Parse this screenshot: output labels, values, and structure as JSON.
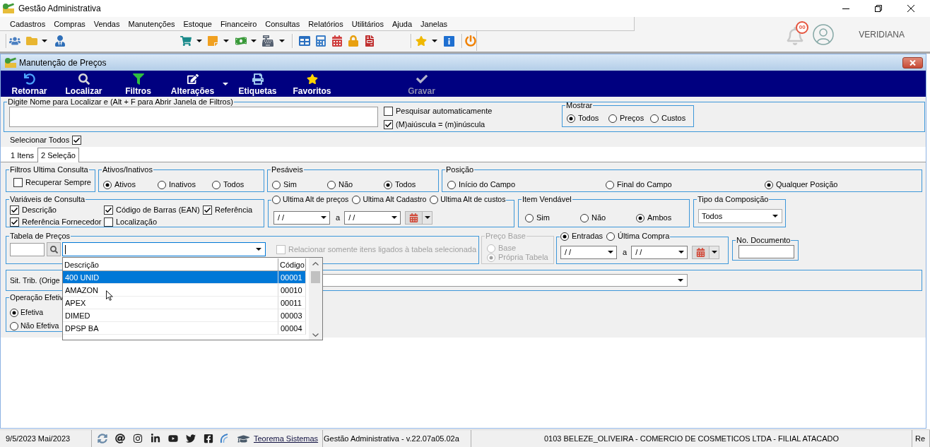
{
  "app_window": {
    "title": "Gestão Administrativa"
  },
  "menu_bar": [
    "Cadastros",
    "Compras",
    "Vendas",
    "Manutenções",
    "Estoque",
    "Financeiro",
    "Consultas",
    "Relatórios",
    "Utilitários",
    "Ajuda",
    "Janelas"
  ],
  "user_area": {
    "notifications": "00",
    "user_name": "VERIDIANA"
  },
  "child_window": {
    "title": "Manutenção de Preços"
  },
  "action_bar": [
    {
      "kind": "return",
      "label": "Retornar",
      "disabled": false,
      "has_menu": false
    },
    {
      "kind": "search",
      "label": "Localizar",
      "disabled": false,
      "has_menu": false
    },
    {
      "kind": "filter",
      "label": "Filtros",
      "disabled": false,
      "has_menu": false
    },
    {
      "kind": "edit",
      "label": "Alterações",
      "disabled": false,
      "has_menu": true
    },
    {
      "kind": "print",
      "label": "Etiquetas",
      "disabled": false,
      "has_menu": false
    },
    {
      "kind": "favorite",
      "label": "Favoritos",
      "disabled": false,
      "has_menu": false
    },
    {
      "kind": "save",
      "label": "Gravar",
      "disabled": true,
      "has_menu": false
    }
  ],
  "search": {
    "label": "Digite Nome para Localizar e (Alt + F para Abrir Janela de Filtros)",
    "options": [
      {
        "label": "Pesquisar automaticamente",
        "checked": false
      },
      {
        "label": "(M)aiúscula = (m)inúscula",
        "checked": true
      }
    ],
    "show": {
      "label": "Mostrar",
      "options": [
        {
          "label": "Todos",
          "selected": true
        },
        {
          "label": "Preços",
          "selected": false
        },
        {
          "label": "Custos",
          "selected": false
        }
      ]
    }
  },
  "select_all": {
    "label": "Selecionar Todos",
    "checked": true
  },
  "tabs": [
    {
      "label": "1 Itens",
      "selected": false
    },
    {
      "label": "2 Seleção",
      "selected": true
    }
  ],
  "filters": {
    "last_query": {
      "label": "Filtros Ultima Consulta",
      "option": {
        "label": "Recuperar Sempre",
        "checked": false
      }
    },
    "active_status": {
      "label": "Ativos/Inativos",
      "options": [
        {
          "label": "Ativos",
          "selected": true
        },
        {
          "label": "Inativos",
          "selected": false
        },
        {
          "label": "Todos",
          "selected": false
        }
      ]
    },
    "weighable": {
      "label": "Pesáveis",
      "options": [
        {
          "label": "Sim",
          "selected": false
        },
        {
          "label": "Não",
          "selected": false
        },
        {
          "label": "Todos",
          "selected": true
        }
      ]
    },
    "position": {
      "label": "Posição",
      "options": [
        {
          "label": "Início do Campo",
          "selected": false
        },
        {
          "label": "Final do Campo",
          "selected": false
        },
        {
          "label": "Qualquer Posição",
          "selected": true
        }
      ]
    },
    "query_fields": {
      "label": "Variáveis de Consulta",
      "options": [
        {
          "label": "Descrição",
          "checked": true
        },
        {
          "label": "Código de Barras (EAN)",
          "checked": true
        },
        {
          "label": "Referência",
          "checked": true
        },
        {
          "label": "Referência Fornecedor",
          "checked": true
        },
        {
          "label": "Localização",
          "checked": false
        }
      ]
    },
    "change_date": {
      "options": [
        {
          "label": "Ultima Alt de preços",
          "selected": false
        },
        {
          "label": "Ultima Alt Cadastro",
          "selected": false
        },
        {
          "label": "Ultima Alt de custos",
          "selected": false
        }
      ],
      "from": "/ /",
      "separator": "a",
      "to": "/ /"
    },
    "sellable": {
      "label": "Item Vendável",
      "options": [
        {
          "label": "Sim",
          "selected": false
        },
        {
          "label": "Não",
          "selected": false
        },
        {
          "label": "Ambos",
          "selected": true
        }
      ]
    },
    "composition": {
      "label": "Tipo da Composição",
      "value": "Todos"
    },
    "price_table": {
      "label": "Tabela de Preços",
      "linked_only": {
        "label": "Relacionar somente itens ligados à tabela selecionada",
        "checked": false,
        "disabled": true
      },
      "list": {
        "columns": [
          "Descrição",
          "Código"
        ],
        "rows": [
          {
            "description": "400 UNID",
            "code": "00001",
            "selected": true
          },
          {
            "description": "AMAZON",
            "code": "00010",
            "selected": false
          },
          {
            "description": "APEX",
            "code": "00011",
            "selected": false
          },
          {
            "description": "DIMED",
            "code": "00003",
            "selected": false
          },
          {
            "description": "DPSP BA",
            "code": "00004",
            "selected": false
          }
        ]
      }
    },
    "price_base": {
      "label": "Preço Base",
      "disabled": true,
      "options": [
        {
          "label": "Base",
          "selected": false
        },
        {
          "label": "Própria Tabela",
          "selected": true
        }
      ]
    },
    "purchase_date": {
      "options": [
        {
          "label": "Entradas",
          "selected": true
        },
        {
          "label": "Última Compra",
          "selected": false
        }
      ],
      "from": "/ /",
      "separator": "a",
      "to": "/ /"
    },
    "document_number": {
      "label": "No. Documento"
    },
    "tax_status": {
      "label": "Sit. Trib. (Orige"
    },
    "operation": {
      "label": "Operação Efetiv",
      "options": [
        {
          "label": "Efetiva",
          "selected": true
        },
        {
          "label": "Não Efetiva",
          "selected": false
        }
      ]
    }
  },
  "status_bar": {
    "date": "9/5/2023 Mai/2023",
    "link": "Teorema Sistemas",
    "version": "Gestão Administrativa - v.22.07a05.02a",
    "company": "0103 BELEZE_OLIVEIRA - COMERCIO DE COSMETICOS LTDA - FILIAL ATACADO",
    "cut_text": "Re"
  }
}
